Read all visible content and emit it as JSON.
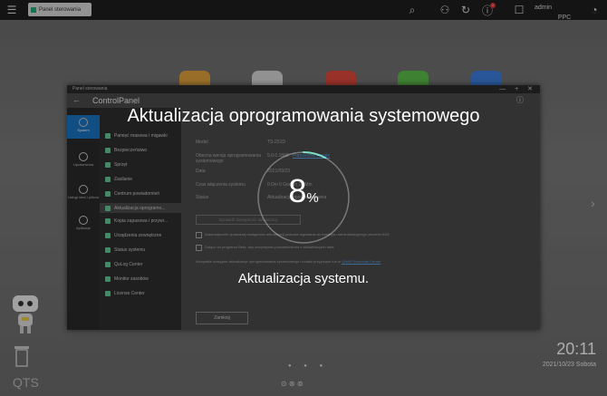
{
  "topbar": {
    "menu_icon": "hamburger-icon",
    "window_tab": "Panel sterowania",
    "notification_count": "1",
    "user": "admin"
  },
  "watermark": "PPC",
  "control_panel": {
    "window_title": "Panel sterowania",
    "header_title": "ControlPanel",
    "sidebar": [
      "System",
      "Uprawnienia",
      "Usługi sieci i plików",
      "Aplikacje"
    ],
    "menu": [
      "Pamięć masowa i migawki",
      "Bezpieczeństwo",
      "Sprzęt",
      "Zasilanie",
      "Centrum powiadomień",
      "Aktualizacja oprogramo...",
      "Kopia zapasowa i przywr...",
      "Urządzenia zewnętrzne",
      "Status systemu",
      "QuLog Center",
      "Monitor zasobów",
      "License Center"
    ],
    "content": {
      "model_label": "Model",
      "model_value": "TS-251D",
      "version_label": "Obecna wersja oprogramowania systemowego",
      "version_value": "5.0.0.1808",
      "version_link": "Poprzednie wersje",
      "date_label": "Data",
      "date_value": "2021/09/23",
      "uptime_label": "Czas włączenia systemu",
      "uptime_value": "0 Dni 0 Godzin 14 Min",
      "status_label": "Status",
      "status_value": "Aktualizacja oprogramowania",
      "check_button": "Sprawdź dostępność aktualizacji",
      "checkbox1": "Automatycznie sprawdzaj dostępność aktualizacji podczas logowania do interfejsu administracyjnego serwera NAS",
      "checkbox2": "Dołącz do programu Beta, aby otrzymywać powiadomienia o aktualizacjach beta",
      "footer_text": "Wszystkie dostępne aktualizacje oprogramowania systemowego i notatki przypisane lub w",
      "footer_link": "QNAP Download Center",
      "close_button": "Zamknij"
    }
  },
  "overlay": {
    "title": "Aktualizacja oprogramowania systemowego",
    "percent": "8",
    "percent_unit": "%",
    "progress": 0.08,
    "status": "Aktualizacja systemu."
  },
  "desktop": {
    "qts_label": "QTS",
    "time": "20:11",
    "date": "2021/10/23 Sobota"
  },
  "colors": {
    "accent": "#1a73c2",
    "progress_arc": "#7fe0c8",
    "background": "#6e6e6e"
  }
}
